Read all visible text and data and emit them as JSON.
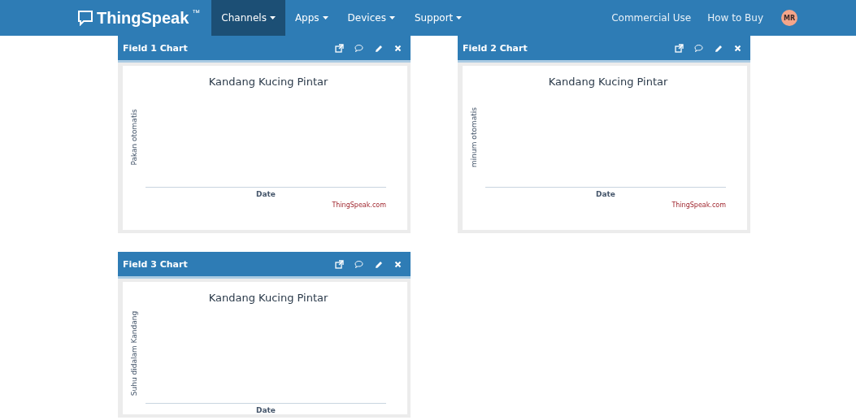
{
  "navbar": {
    "brand": "ThingSpeak",
    "brand_mark": "™",
    "menu": [
      {
        "label": "Channels",
        "selected": true,
        "dropdown": true
      },
      {
        "label": "Apps",
        "selected": false,
        "dropdown": true
      },
      {
        "label": "Devices",
        "selected": false,
        "dropdown": true
      },
      {
        "label": "Support",
        "selected": false,
        "dropdown": true
      }
    ],
    "right_links": [
      "Commercial Use",
      "How to Buy"
    ],
    "avatar": "MR"
  },
  "cards": [
    {
      "title": "Field 1 Chart",
      "chart_title": "Kandang Kucing Pintar",
      "ylabel": "Pakan otomatis",
      "xlabel": "Date",
      "credit": "ThingSpeak.com"
    },
    {
      "title": "Field 2 Chart",
      "chart_title": "Kandang Kucing Pintar",
      "ylabel": "minum otomatis",
      "xlabel": "Date",
      "credit": "ThingSpeak.com"
    },
    {
      "title": "Field 3 Chart",
      "chart_title": "Kandang Kucing Pintar",
      "ylabel": "Suhu didalam Kandang",
      "xlabel": "Date"
    }
  ]
}
